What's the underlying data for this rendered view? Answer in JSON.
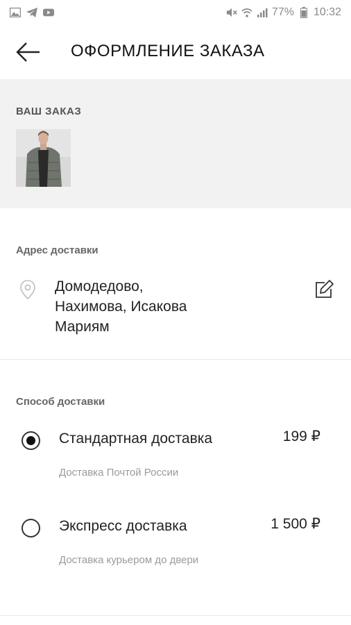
{
  "status_bar": {
    "icons_left": [
      "image-icon",
      "telegram-icon",
      "youtube-icon"
    ],
    "icons_right": [
      "mute-icon",
      "wifi-icon",
      "signal-icon"
    ],
    "battery": "77%",
    "time": "10:32"
  },
  "header": {
    "title": "ОФОРМЛЕНИЕ ЗАКАЗА"
  },
  "order": {
    "label": "ВАШ ЗАКАЗ"
  },
  "address": {
    "label": "Адрес доставки",
    "lines": [
      "Домодедово,",
      "Нахимова, Исакова",
      "Мариям"
    ]
  },
  "delivery": {
    "label": "Способ доставки",
    "options": [
      {
        "title": "Стандартная доставка",
        "price": "199 ₽",
        "subtitle": "Доставка Почтой России",
        "selected": true
      },
      {
        "title": "Экспресс доставка",
        "price": "1 500 ₽",
        "subtitle": "Доставка курьером до двери",
        "selected": false
      }
    ]
  },
  "colors": {
    "gray_section": "#f2f2f2",
    "text_primary": "#222222",
    "text_secondary": "#9a9a9a"
  }
}
